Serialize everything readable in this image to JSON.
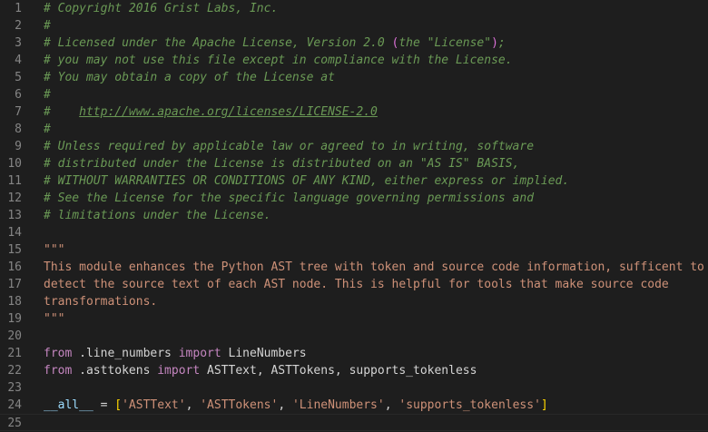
{
  "lines": [
    {
      "n": "1",
      "tokens": [
        {
          "t": "comment",
          "v": "# Copyright 2016 Grist Labs, Inc."
        }
      ]
    },
    {
      "n": "2",
      "tokens": [
        {
          "t": "comment",
          "v": "#"
        }
      ]
    },
    {
      "n": "3",
      "tokens": [
        {
          "t": "comment",
          "v": "# Licensed under the Apache License, Version 2.0 "
        },
        {
          "t": "qparen",
          "v": "("
        },
        {
          "t": "comment",
          "v": "the \"License\""
        },
        {
          "t": "qparen",
          "v": ")"
        },
        {
          "t": "comment",
          "v": ";"
        }
      ]
    },
    {
      "n": "4",
      "tokens": [
        {
          "t": "comment",
          "v": "# you may not use this file except in compliance with the License."
        }
      ]
    },
    {
      "n": "5",
      "tokens": [
        {
          "t": "comment",
          "v": "# You may obtain a copy of the License at"
        }
      ]
    },
    {
      "n": "6",
      "tokens": [
        {
          "t": "comment",
          "v": "#"
        }
      ]
    },
    {
      "n": "7",
      "tokens": [
        {
          "t": "comment",
          "v": "#    "
        },
        {
          "t": "link",
          "v": "http://www.apache.org/licenses/LICENSE-2.0"
        }
      ]
    },
    {
      "n": "8",
      "tokens": [
        {
          "t": "comment",
          "v": "#"
        }
      ]
    },
    {
      "n": "9",
      "tokens": [
        {
          "t": "comment",
          "v": "# Unless required by applicable law or agreed to in writing, software"
        }
      ]
    },
    {
      "n": "10",
      "tokens": [
        {
          "t": "comment",
          "v": "# distributed under the License is distributed on an \"AS IS\" BASIS,"
        }
      ]
    },
    {
      "n": "11",
      "tokens": [
        {
          "t": "comment",
          "v": "# WITHOUT WARRANTIES OR CONDITIONS OF ANY KIND, either express or implied."
        }
      ]
    },
    {
      "n": "12",
      "tokens": [
        {
          "t": "comment",
          "v": "# See the License for the specific language governing permissions and"
        }
      ]
    },
    {
      "n": "13",
      "tokens": [
        {
          "t": "comment",
          "v": "# limitations under the License."
        }
      ]
    },
    {
      "n": "14",
      "tokens": []
    },
    {
      "n": "15",
      "tokens": [
        {
          "t": "doc",
          "v": "\"\"\""
        }
      ]
    },
    {
      "n": "16",
      "tokens": [
        {
          "t": "doc",
          "v": "This module enhances the Python AST tree with token and source code information, sufficent to"
        }
      ]
    },
    {
      "n": "17",
      "tokens": [
        {
          "t": "doc",
          "v": "detect the source text of each AST node. This is helpful for tools that make source code"
        }
      ]
    },
    {
      "n": "18",
      "tokens": [
        {
          "t": "doc",
          "v": "transformations."
        }
      ]
    },
    {
      "n": "19",
      "tokens": [
        {
          "t": "doc",
          "v": "\"\"\""
        }
      ]
    },
    {
      "n": "20",
      "tokens": []
    },
    {
      "n": "21",
      "tokens": [
        {
          "t": "kw",
          "v": "from"
        },
        {
          "t": "plain",
          "v": " .line_numbers "
        },
        {
          "t": "kw",
          "v": "import"
        },
        {
          "t": "plain",
          "v": " LineNumbers"
        }
      ]
    },
    {
      "n": "22",
      "tokens": [
        {
          "t": "kw",
          "v": "from"
        },
        {
          "t": "plain",
          "v": " .asttokens "
        },
        {
          "t": "kw",
          "v": "import"
        },
        {
          "t": "plain",
          "v": " ASTText, ASTTokens, supports_tokenless"
        }
      ]
    },
    {
      "n": "23",
      "tokens": []
    },
    {
      "n": "24",
      "tokens": [
        {
          "t": "var",
          "v": "__all__"
        },
        {
          "t": "punc",
          "v": " = "
        },
        {
          "t": "bracket",
          "v": "["
        },
        {
          "t": "str",
          "v": "'ASTText'"
        },
        {
          "t": "punc",
          "v": ", "
        },
        {
          "t": "str",
          "v": "'ASTTokens'"
        },
        {
          "t": "punc",
          "v": ", "
        },
        {
          "t": "str",
          "v": "'LineNumbers'"
        },
        {
          "t": "punc",
          "v": ", "
        },
        {
          "t": "str",
          "v": "'supports_tokenless'"
        },
        {
          "t": "bracket",
          "v": "]"
        }
      ]
    },
    {
      "n": "25",
      "tokens": []
    }
  ],
  "current_line": "25"
}
